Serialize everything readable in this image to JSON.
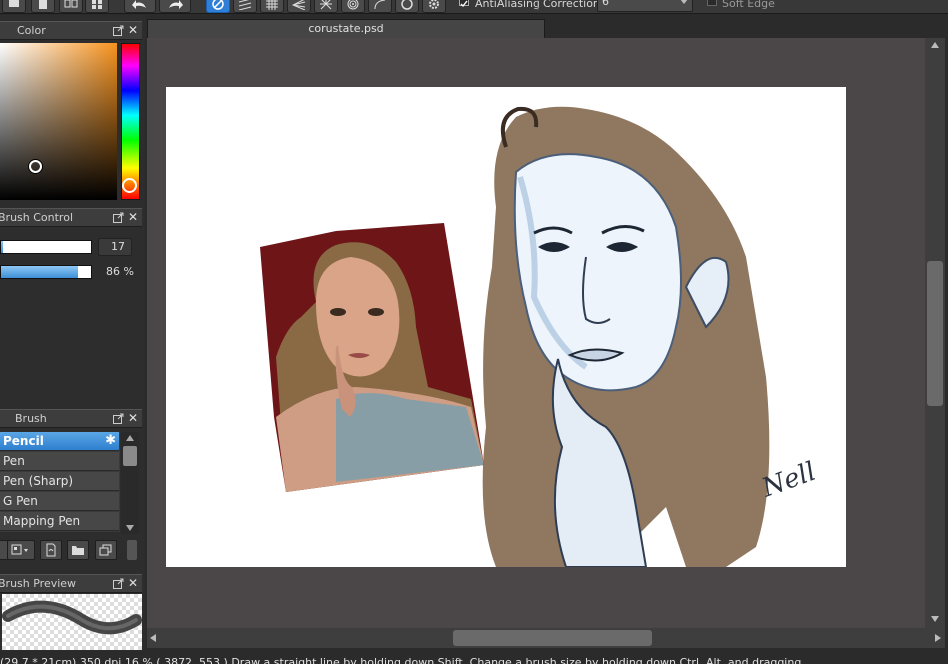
{
  "toolbar": {
    "antialiasing_label": "AntiAliasing",
    "correction_label": "Correction",
    "correction_value": "6",
    "soft_edge_label": "Soft Edge"
  },
  "panels": {
    "color": {
      "title": "Color"
    },
    "brush_control": {
      "title": "Brush Control",
      "size_value": "17",
      "density_text": "86 %",
      "size_fraction": 0.02,
      "density_fraction": 0.86
    },
    "brush": {
      "title": "Brush",
      "items": [
        {
          "label": "Pencil",
          "selected": true
        },
        {
          "label": "Pen",
          "selected": false
        },
        {
          "label": "Pen (Sharp)",
          "selected": false
        },
        {
          "label": "G Pen",
          "selected": false
        },
        {
          "label": "Mapping Pen",
          "selected": false
        }
      ]
    },
    "brush_preview": {
      "title": "Brush Preview"
    }
  },
  "document": {
    "tab_title": "corustate.psd"
  },
  "signature_text": "Nell",
  "statusbar": {
    "text": "(29.7 * 21cm)  350 dpi  16 %  ( 3872, 553 )  Draw a straight line by holding down Shift, Change a brush size by holding down Ctrl, Alt, and dragging"
  },
  "colors": {
    "accent": "#2f7fd8",
    "panel_bg": "#2d2d2d",
    "canvas_bg": "#4b4647",
    "photo_backdrop": "#6e1518"
  }
}
